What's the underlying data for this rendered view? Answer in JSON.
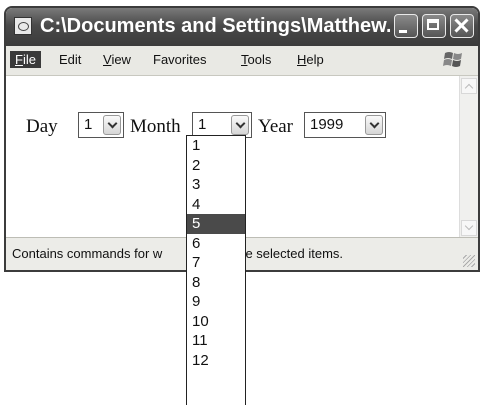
{
  "window": {
    "title": "C:\\Documents and Settings\\Matthew...",
    "colors": {
      "titlebar": "#4a4a4a",
      "selection": "#4a4a4a",
      "menubar": "#e9e9e4"
    }
  },
  "menu": {
    "items": [
      {
        "first": "F",
        "rest": "ile"
      },
      {
        "first": "",
        "rest": "Edit"
      },
      {
        "first": "V",
        "rest": "iew"
      },
      {
        "first": "",
        "rest": "Favorites"
      },
      {
        "first": "T",
        "rest": "ools"
      },
      {
        "first": "H",
        "rest": "elp"
      }
    ],
    "accel_labels": [
      "File",
      "Edit",
      "View",
      "Favorites",
      "Tools",
      "Help"
    ]
  },
  "form": {
    "day_label": "Day",
    "day_value": "1",
    "month_label": "Month",
    "month_value": "1",
    "year_label": "Year",
    "year_value": "1999"
  },
  "month_options": [
    "1",
    "2",
    "3",
    "4",
    "5",
    "6",
    "7",
    "8",
    "9",
    "10",
    "11",
    "12"
  ],
  "month_highlighted_index": 4,
  "status": {
    "left": "Contains commands for w",
    "right": "ith the selected items."
  },
  "icons": [
    "app-icon",
    "minimize-icon",
    "maximize-icon",
    "close-icon",
    "windows-logo-icon",
    "scroll-up-icon",
    "scroll-down-icon",
    "size-grip-icon"
  ]
}
